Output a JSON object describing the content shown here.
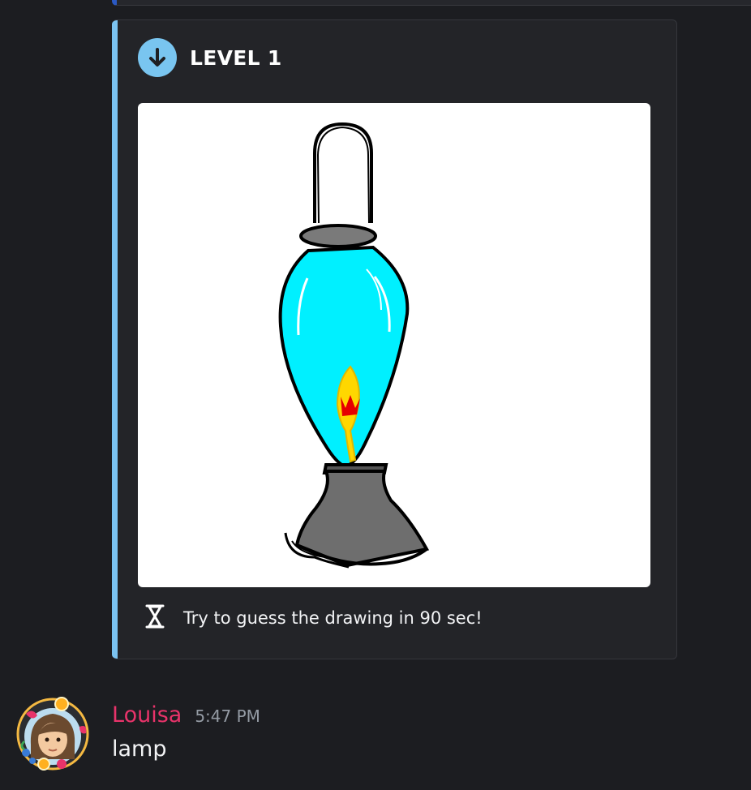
{
  "embed": {
    "accent_color": "#7bc3f1",
    "icon": "arrow-down-circle-icon",
    "title": "LEVEL 1",
    "image_alt": "drawing of a lava lamp",
    "footer_icon": "hourglass-icon",
    "footer_text": "Try to guess the drawing in 90 sec!"
  },
  "message": {
    "avatar": "user-avatar",
    "username": "Louisa",
    "username_color": "#e8336a",
    "timestamp": "5:47 PM",
    "content": "lamp"
  }
}
